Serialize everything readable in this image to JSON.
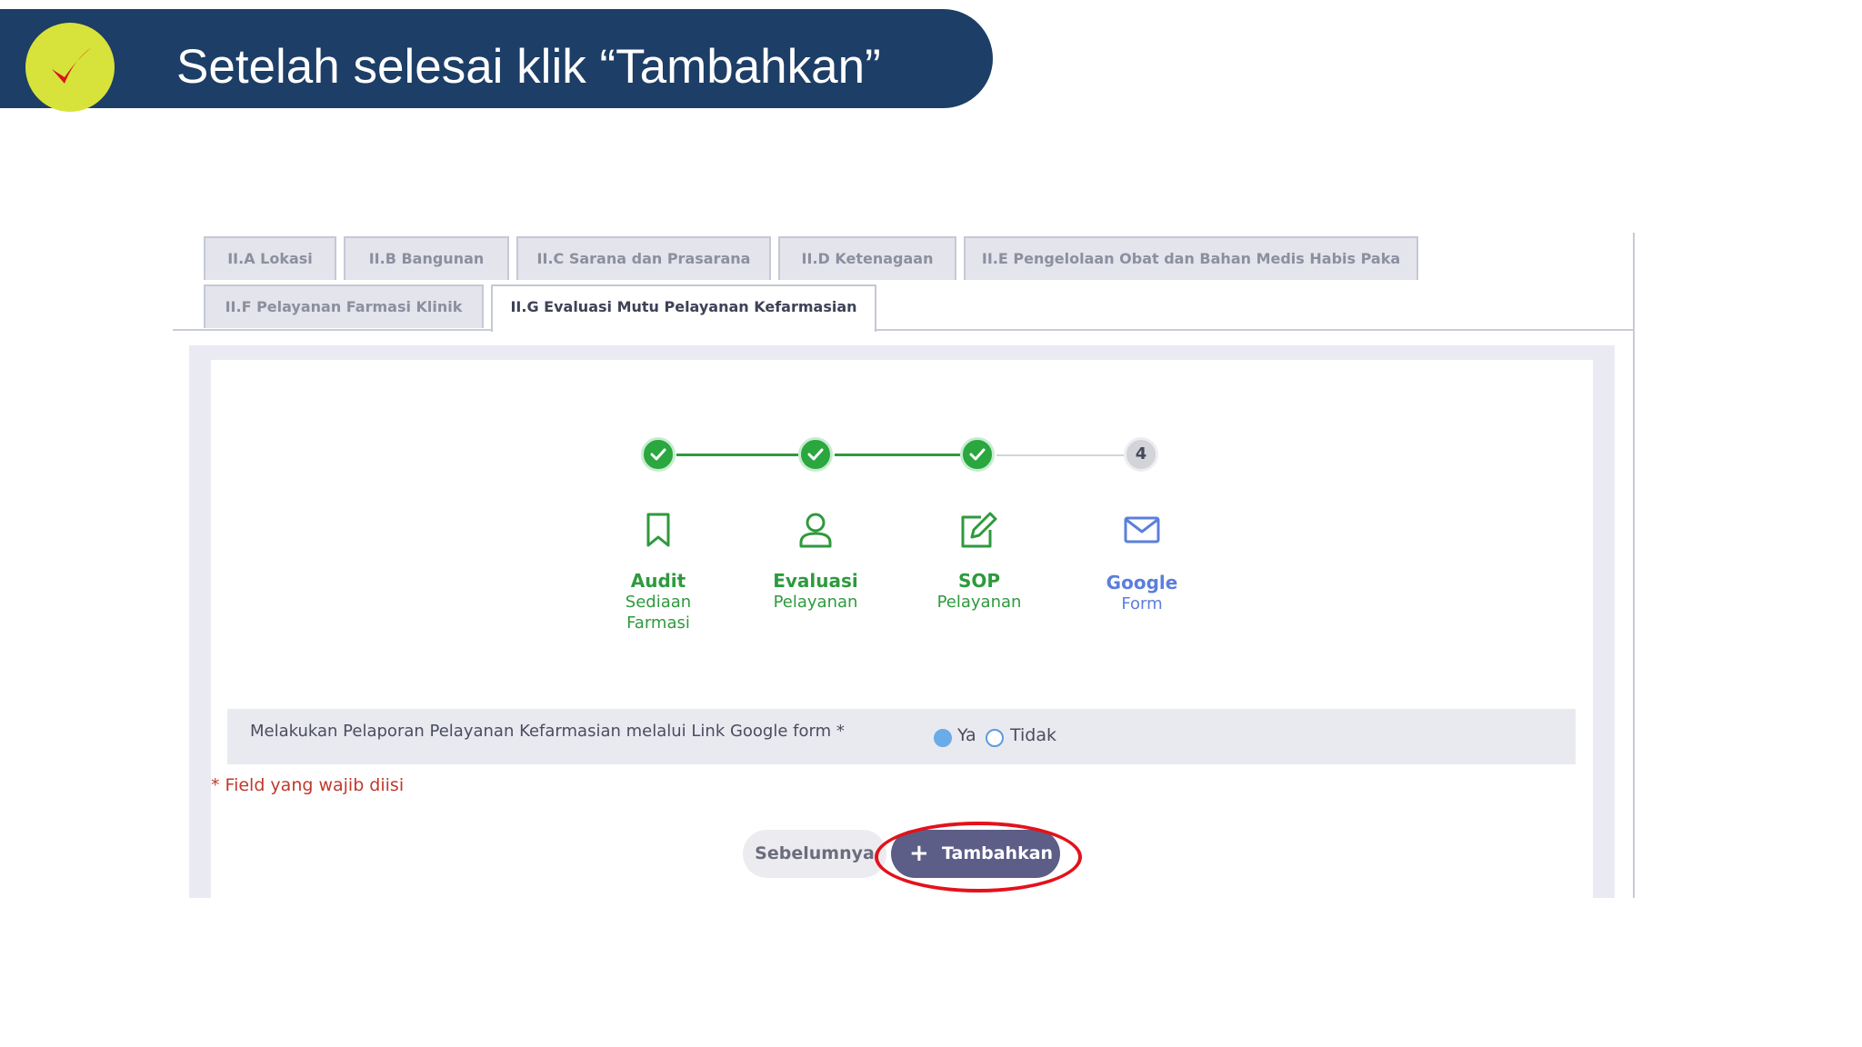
{
  "banner": {
    "title": "Setelah selesai klik “Tambahkan”",
    "check_icon": "check-icon",
    "check_color": "#d6141c",
    "bg_color": "#1d3e66",
    "circle_color": "#d7e33a"
  },
  "tabs": [
    {
      "label": "II.A Lokasi",
      "active": false
    },
    {
      "label": "II.B Bangunan",
      "active": false
    },
    {
      "label": "II.C Sarana dan Prasarana",
      "active": false
    },
    {
      "label": "II.D Ketenagaan",
      "active": false
    },
    {
      "label": "II.E Pengelolaan Obat dan Bahan Medis Habis Paka",
      "active": false
    },
    {
      "label": "II.F Pelayanan Farmasi Klinik",
      "active": false
    },
    {
      "label": "II.G Evaluasi Mutu Pelayanan Kefarmasian",
      "active": true
    }
  ],
  "stepper": {
    "steps": [
      {
        "status": "done",
        "icon": "bookmark-icon",
        "title": "Audit",
        "sub1": "Sediaan",
        "sub2": "Farmasi"
      },
      {
        "status": "done",
        "icon": "user-icon",
        "title": "Evaluasi",
        "sub1": "Pelayanan"
      },
      {
        "status": "done",
        "icon": "edit-icon",
        "title": "SOP",
        "sub1": "Pelayanan"
      },
      {
        "status": "current",
        "number": "4",
        "icon": "mail-icon",
        "title": "Google",
        "sub1": "Form"
      }
    ],
    "done_color": "#2e9a3d",
    "current_color": "#5b7fdb"
  },
  "form": {
    "question": "Melakukan Pelaporan Pelayanan Kefarmasian melalui Link Google form *",
    "options": [
      {
        "label": "Ya",
        "selected": true
      },
      {
        "label": "Tidak",
        "selected": false
      }
    ],
    "required_note": "* Field yang wajib diisi"
  },
  "buttons": {
    "previous": "Sebelumnya",
    "add": "Tambahkan",
    "add_icon": "plus-icon",
    "highlight_color": "#e3121b"
  }
}
